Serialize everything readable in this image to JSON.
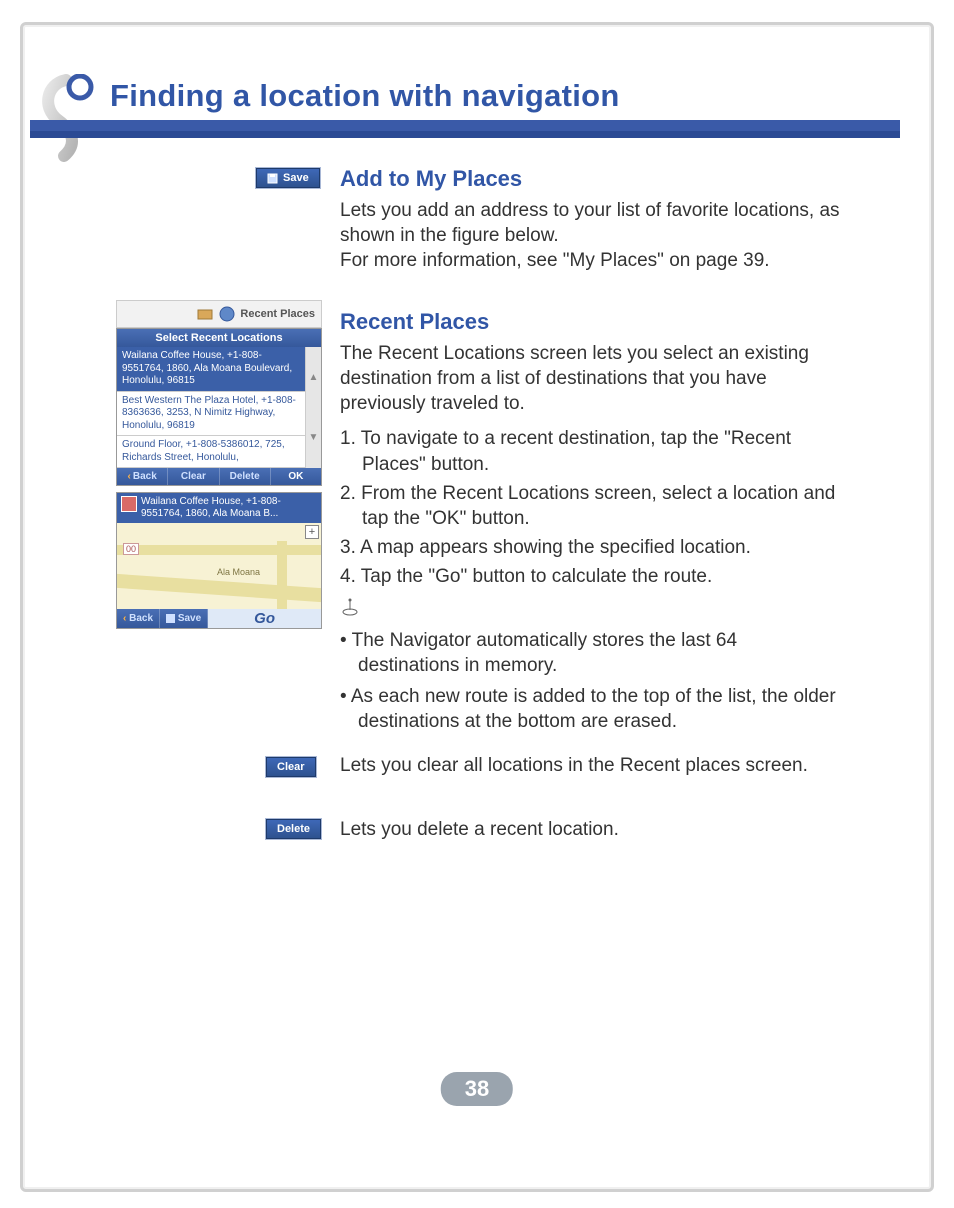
{
  "page": {
    "title": "Finding a location with navigation",
    "number": "38"
  },
  "save_button": {
    "label": "Save"
  },
  "sections": {
    "add": {
      "heading": "Add to My Places",
      "p1": "Lets you add an address to your list of favorite locations, as shown in the figure below.",
      "p2": "For more information, see \"My Places\" on page 39."
    },
    "recent": {
      "heading": "Recent Places",
      "intro": "The Recent Locations screen lets you select an existing destination from a list of destinations that you have previously traveled to.",
      "steps": [
        "1. To navigate to a recent destination, tap the \"Recent Places\" button.",
        "2. From the Recent Locations screen, select a location and tap the \"OK\" button.",
        "3. A map appears showing the specified location.",
        "4. Tap the \"Go\" button to calculate the route."
      ],
      "bullets": [
        "• The Navigator automatically stores the last 64 destinations in memory.",
        "• As each new route is added to the top of the list, the older destinations at the bottom are erased."
      ]
    }
  },
  "clear": {
    "label": "Clear",
    "desc": "Lets you clear all locations in the Recent places screen."
  },
  "delete": {
    "label": "Delete",
    "desc": "Lets you delete a recent location."
  },
  "figure": {
    "header_label": "Recent Places",
    "panel_title": "Select Recent Locations",
    "rows": [
      "Wailana Coffee House, +1-808-9551764, 1860, Ala Moana Boulevard, Honolulu, 96815",
      "Best Western The Plaza Hotel, +1-808-8363636, 3253, N Nimitz Highway, Honolulu, 96819",
      "Ground Floor, +1-808-5386012, 725, Richards Street, Honolulu,"
    ],
    "buttons": {
      "back": "Back",
      "clear": "Clear",
      "delete": "Delete",
      "ok": "OK"
    },
    "map_title": "Wailana Coffee House, +1-808-9551764, 1860, Ala Moana B...",
    "map_label": "Ala Moana",
    "map_buttons": {
      "back": "Back",
      "save": "Save",
      "go": "Go"
    }
  }
}
